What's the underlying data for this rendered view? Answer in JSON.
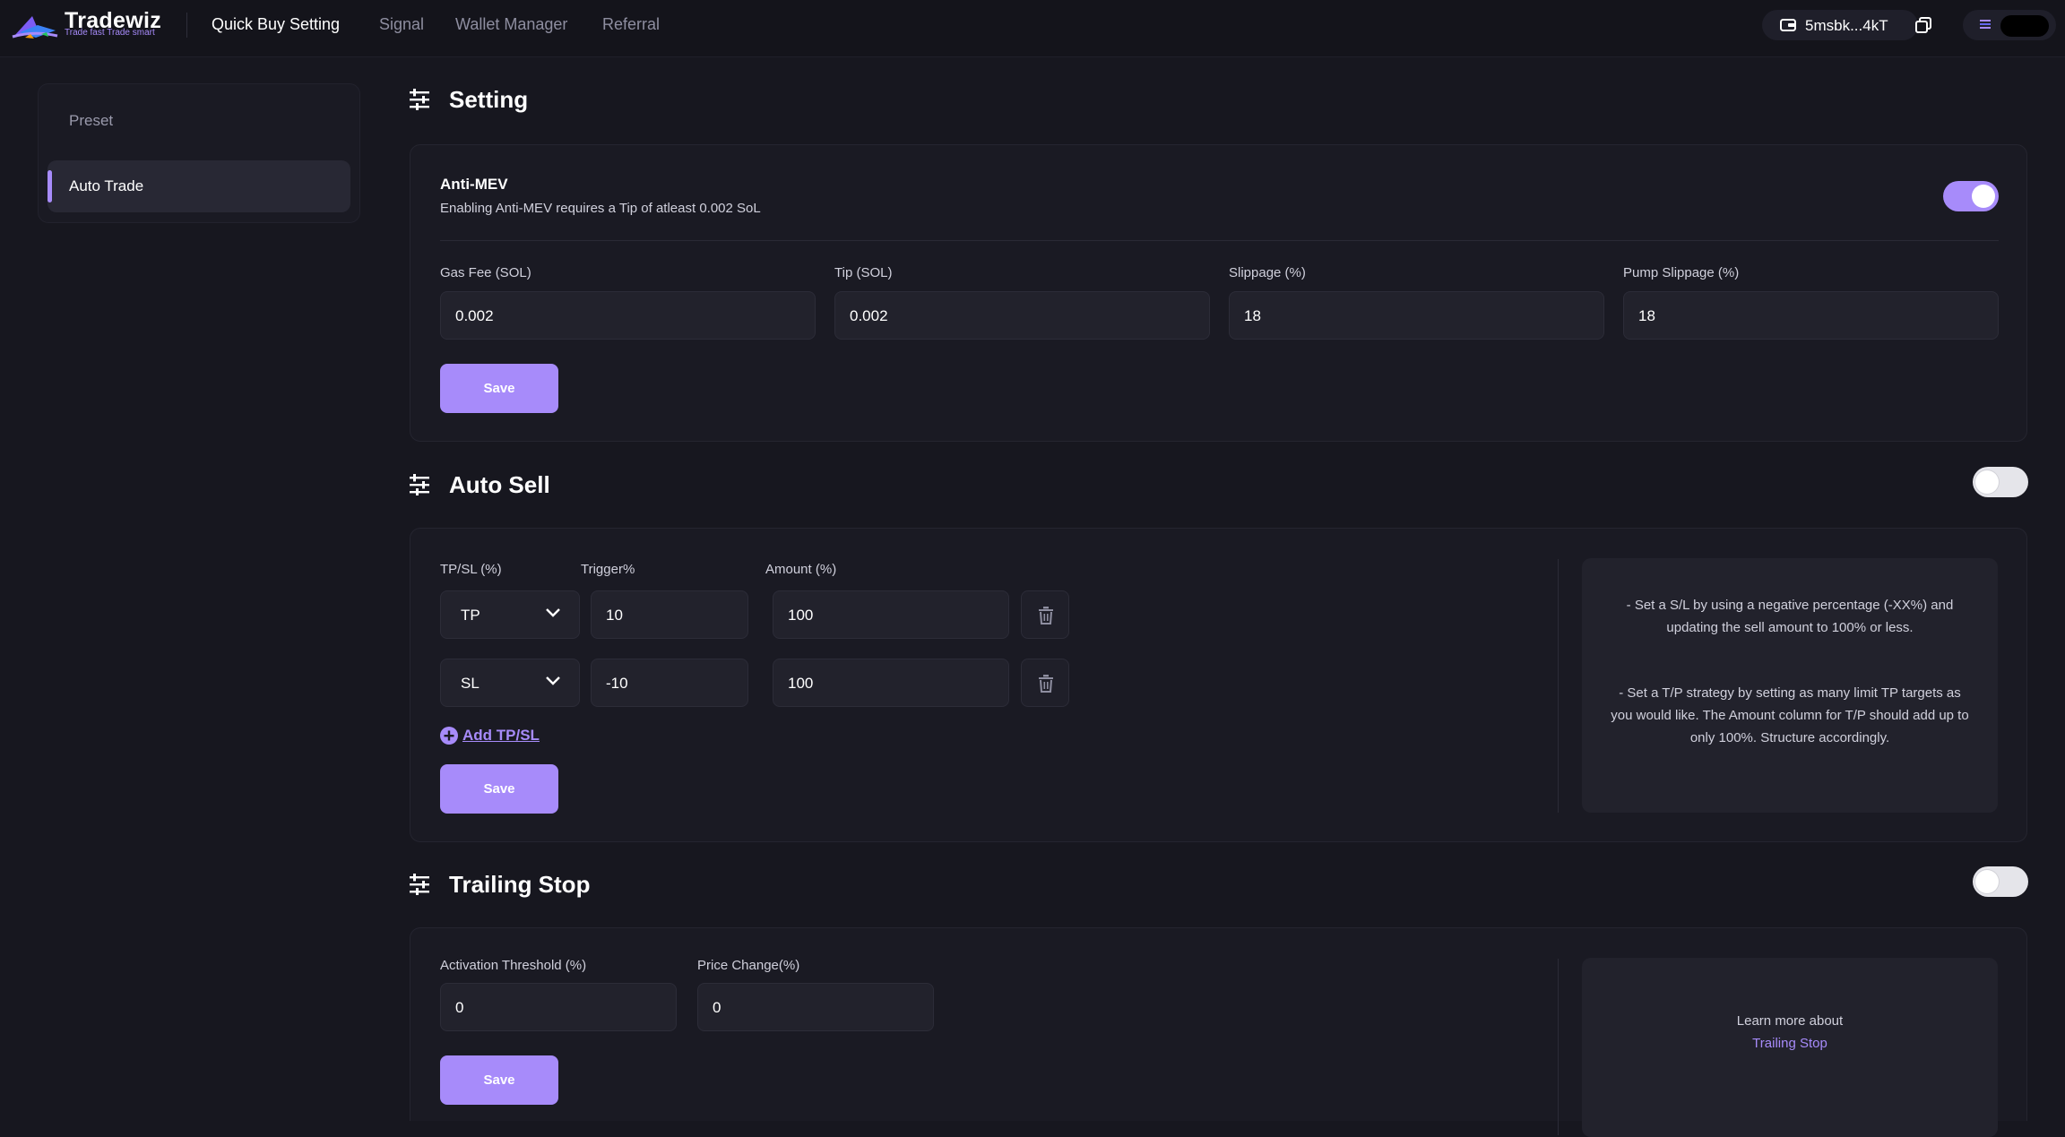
{
  "brand": {
    "name": "Tradewiz",
    "tagline": "Trade fast Trade smart"
  },
  "nav": {
    "links": [
      "Quick Buy Setting",
      "Signal",
      "Wallet Manager",
      "Referral"
    ],
    "active": "Quick Buy Setting"
  },
  "wallet": {
    "address": "5msbk...4kT"
  },
  "sidebar": {
    "items": [
      {
        "label": "Preset",
        "active": false
      },
      {
        "label": "Auto Trade",
        "active": true
      }
    ]
  },
  "setting": {
    "title": "Setting",
    "anti_mev": {
      "title": "Anti-MEV",
      "description": "Enabling Anti-MEV requires a Tip of atleast 0.002 SoL",
      "enabled": true
    },
    "fields": [
      {
        "label": "Gas Fee (SOL)",
        "value": "0.002"
      },
      {
        "label": "Tip (SOL)",
        "value": "0.002"
      },
      {
        "label": "Slippage (%)",
        "value": "18"
      },
      {
        "label": "Pump Slippage (%)",
        "value": "18"
      }
    ],
    "save_label": "Save"
  },
  "auto_sell": {
    "title": "Auto Sell",
    "enabled": false,
    "headers": {
      "type": "TP/SL (%)",
      "trigger": "Trigger%",
      "amount": "Amount (%)"
    },
    "rows": [
      {
        "type": "TP",
        "trigger": "10",
        "amount": "100"
      },
      {
        "type": "SL",
        "trigger": "-10",
        "amount": "100"
      }
    ],
    "add_label": "Add TP/SL",
    "save_label": "Save",
    "info": [
      "- Set a S/L by using a negative percentage (-XX%) and updating the sell amount to 100% or less.",
      "- Set a T/P strategy by setting as many limit TP targets as you would like. The Amount column for T/P should add up to only 100%. Structure accordingly."
    ]
  },
  "trailing_stop": {
    "title": "Trailing Stop",
    "enabled": false,
    "fields": [
      {
        "label": "Activation Threshold (%)",
        "value": "0"
      },
      {
        "label": "Price Change(%)",
        "value": "0"
      }
    ],
    "save_label": "Save",
    "info_text": "Learn more about",
    "info_link": "Trailing Stop"
  },
  "colors": {
    "accent": "#a78bfa",
    "background": "#17171f",
    "card": "#1a1a23",
    "input": "#22222c"
  }
}
